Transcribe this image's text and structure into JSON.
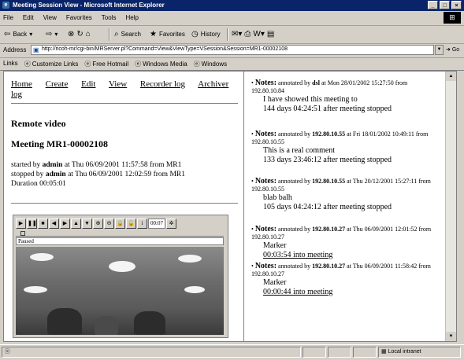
{
  "window": {
    "title": "Meeting Session View - Microsoft Internet Explorer"
  },
  "menu": [
    "File",
    "Edit",
    "View",
    "Favorites",
    "Tools",
    "Help"
  ],
  "toolbar": {
    "back": "Back",
    "search": "Search",
    "favorites": "Favorites",
    "history": "History"
  },
  "address": {
    "label": "Address",
    "url": "http://ricoh-mr/cgi-bin/MRServer.pl?Command=View&ViewType=VSession&Session=MR1-00002108",
    "go": "Go"
  },
  "links": {
    "label": "Links",
    "items": [
      "Customize Links",
      "Free Hotmail",
      "Windows Media",
      "Windows"
    ]
  },
  "nav": [
    "Home",
    "Create",
    "Edit",
    "View",
    "Recorder log",
    "Archiver log"
  ],
  "remote_video": "Remote video",
  "meeting_title": "Meeting MR1-00002108",
  "meeting_info": {
    "started_pre": "started by ",
    "started_user": "admin",
    "started_post": " at Thu 06/09/2001 11:57:58 from MR1",
    "stopped_pre": "stopped by ",
    "stopped_user": "admin",
    "stopped_post": " at Thu 06/09/2001 12:02:59 from MR1",
    "duration": "Duration 00:05:01"
  },
  "player": {
    "time": "00:07",
    "status": "Paused"
  },
  "notes": [
    {
      "label": "Notes:",
      "pre": " annotated by ",
      "who": "dsl",
      "when": " at Mon 28/01/2002 15:27:50 from 192.80.10.84",
      "text": "I have showed this meeting to",
      "sub": "144 days 04:24:51 after meeting stopped",
      "sub_link": false
    },
    {
      "label": "Notes:",
      "pre": " annotated by ",
      "who": "192.80.10.55",
      "when": " at Fri 18/01/2002 10:49:11 from 192.80.10.55",
      "text": "This is a real comment",
      "sub": "133 days 23:46:12 after meeting stopped",
      "sub_link": false
    },
    {
      "label": "Notes:",
      "pre": " annotated by ",
      "who": "192.80.10.55",
      "when": " at Thu 20/12/2001 15:27:11 from 192.80.10.55",
      "text": "blab balh",
      "sub": "105 days 04:24:12 after meeting stopped",
      "sub_link": false
    },
    {
      "label": "Notes:",
      "pre": " annotated by ",
      "who": "192.80.10.27",
      "when": " at Thu 06/09/2001 12:01:52 from 192.80.10.27",
      "text": "Marker",
      "sub": "00:03:54 into meeting",
      "sub_link": true
    },
    {
      "label": "Notes:",
      "pre": " annotated by ",
      "who": "192.80.10.27",
      "when": " at Thu 06/09/2001 11:58:42 from 192.80.10.27",
      "text": "Marker",
      "sub": "00:00:44 into meeting",
      "sub_link": true
    }
  ],
  "statusbar": {
    "zone": "Local intranet"
  }
}
